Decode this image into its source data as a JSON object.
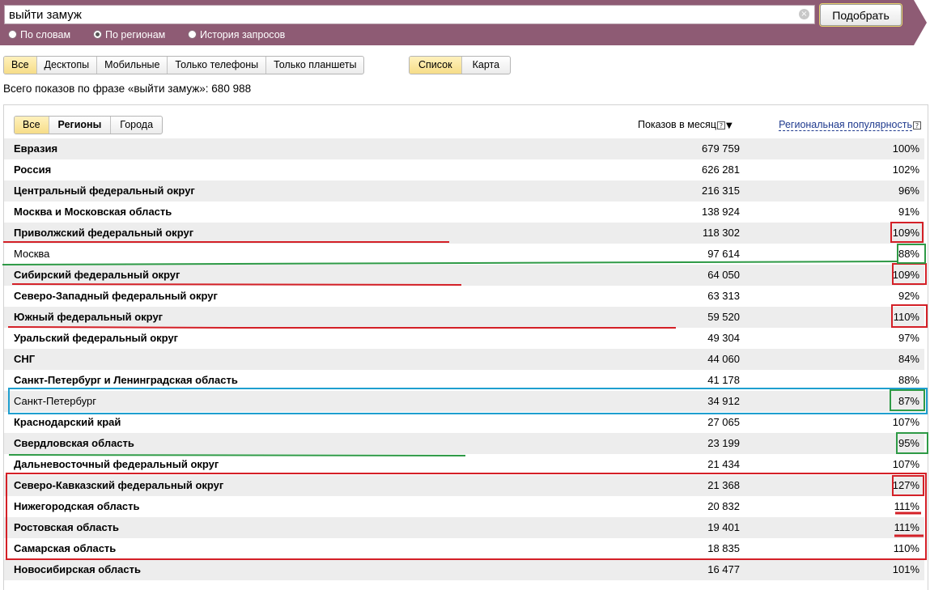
{
  "search": {
    "query": "выйти замуж",
    "clear_glyph": "×",
    "submit_label": "Подобрать",
    "modes": [
      {
        "label": "По словам",
        "selected": false
      },
      {
        "label": "По регионам",
        "selected": true
      },
      {
        "label": "История запросов",
        "selected": false
      }
    ]
  },
  "device_filter": [
    "Все",
    "Десктопы",
    "Мобильные",
    "Только телефоны",
    "Только планшеты"
  ],
  "view_toggle": [
    "Список",
    "Карта"
  ],
  "summary": "Всего показов по фразе «выйти замуж»: 680 988",
  "region_filter": [
    "Все",
    "Регионы",
    "Города"
  ],
  "columns": {
    "shows": "Показов в месяц",
    "popularity": "Региональная популярность",
    "help_glyph": "?",
    "sort_glyph": "▼"
  },
  "rows": [
    {
      "name": "Евразия",
      "shows": "679 759",
      "pop": "100%",
      "bold": true
    },
    {
      "name": "Россия",
      "shows": "626 281",
      "pop": "102%",
      "bold": true
    },
    {
      "name": "Центральный федеральный округ",
      "shows": "216 315",
      "pop": "96%",
      "bold": true
    },
    {
      "name": "Москва и Московская область",
      "shows": "138 924",
      "pop": "91%",
      "bold": true
    },
    {
      "name": "Приволжский федеральный округ",
      "shows": "118 302",
      "pop": "109%",
      "bold": true
    },
    {
      "name": "Москва",
      "shows": "97 614",
      "pop": "88%",
      "bold": false
    },
    {
      "name": "Сибирский федеральный округ",
      "shows": "64 050",
      "pop": "109%",
      "bold": true
    },
    {
      "name": "Северо-Западный федеральный округ",
      "shows": "63 313",
      "pop": "92%",
      "bold": true
    },
    {
      "name": "Южный федеральный округ",
      "shows": "59 520",
      "pop": "110%",
      "bold": true
    },
    {
      "name": "Уральский федеральный округ",
      "shows": "49 304",
      "pop": "97%",
      "bold": true
    },
    {
      "name": "СНГ",
      "shows": "44 060",
      "pop": "84%",
      "bold": true
    },
    {
      "name": "Санкт-Петербург и Ленинградская область",
      "shows": "41 178",
      "pop": "88%",
      "bold": true
    },
    {
      "name": "Санкт-Петербург",
      "shows": "34 912",
      "pop": "87%",
      "bold": false
    },
    {
      "name": "Краснодарский край",
      "shows": "27 065",
      "pop": "107%",
      "bold": true
    },
    {
      "name": "Свердловская область",
      "shows": "23 199",
      "pop": "95%",
      "bold": true
    },
    {
      "name": "Дальневосточный федеральный округ",
      "shows": "21 434",
      "pop": "107%",
      "bold": true
    },
    {
      "name": "Северо-Кавказский федеральный округ",
      "shows": "21 368",
      "pop": "127%",
      "bold": true
    },
    {
      "name": "Нижегородская область",
      "shows": "20 832",
      "pop": "111%",
      "bold": true
    },
    {
      "name": "Ростовская область",
      "shows": "19 401",
      "pop": "111%",
      "bold": true
    },
    {
      "name": "Самарская область",
      "shows": "18 835",
      "pop": "110%",
      "bold": true
    },
    {
      "name": "Новосибирская область",
      "shows": "16 477",
      "pop": "101%",
      "bold": true
    }
  ],
  "colors": {
    "header_band": "#8e5b74",
    "active_tab": "#f6dd88",
    "zebra": "#ededed",
    "mark_red": "#d42027",
    "mark_green": "#2e9a46",
    "mark_blue": "#1f9fcf"
  }
}
